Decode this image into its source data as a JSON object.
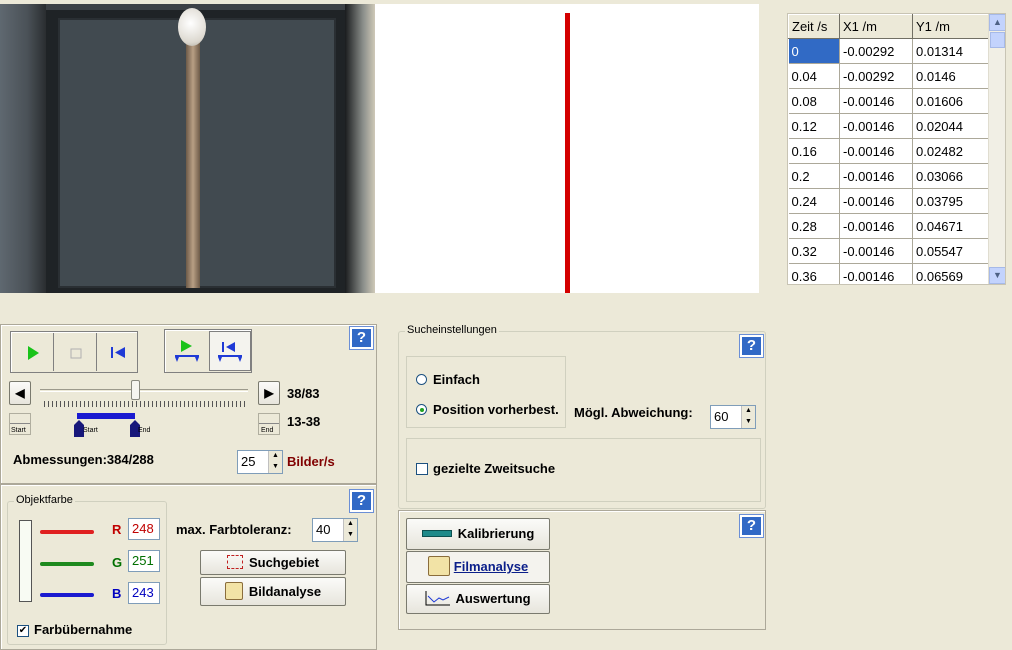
{
  "table": {
    "headers": [
      "Zeit /s",
      "X1 /m",
      "Y1 /m"
    ],
    "rows": [
      [
        "0",
        "-0.00292",
        "0.01314"
      ],
      [
        "0.04",
        "-0.00292",
        "0.0146"
      ],
      [
        "0.08",
        "-0.00146",
        "0.01606"
      ],
      [
        "0.12",
        "-0.00146",
        "0.02044"
      ],
      [
        "0.16",
        "-0.00146",
        "0.02482"
      ],
      [
        "0.2",
        "-0.00146",
        "0.03066"
      ],
      [
        "0.24",
        "-0.00146",
        "0.03795"
      ],
      [
        "0.28",
        "-0.00146",
        "0.04671"
      ],
      [
        "0.32",
        "-0.00146",
        "0.05547"
      ],
      [
        "0.36",
        "-0.00146",
        "0.06569"
      ]
    ]
  },
  "player": {
    "frame_counter": "38/83",
    "range": "13-38",
    "start_label": "Start",
    "end_label": "End",
    "marker_start": "Start",
    "marker_end": "End",
    "dimensions": "Abmessungen:384/288",
    "fps_value": "25",
    "fps_label": "Bilder/s",
    "slider_position": 0.46
  },
  "object_color": {
    "legend": "Objektfarbe",
    "r_label": "R",
    "r_value": "248",
    "g_label": "G",
    "g_value": "251",
    "b_label": "B",
    "b_value": "243",
    "tolerance_label": "max. Farbtoleranz:",
    "tolerance_value": "40",
    "search_area_button": "Suchgebiet",
    "image_analysis_button": "Bildanalyse",
    "color_takeover_label": "Farbübernahme",
    "color_takeover_checked": true,
    "colors": {
      "r": "#e02020",
      "g": "#1e8a1e",
      "b": "#1a1ad0",
      "r_text": "#c00000",
      "g_text": "#007000",
      "b_text": "#0000c0"
    }
  },
  "search": {
    "legend": "Sucheinstellungen",
    "simple_label": "Einfach",
    "position_label": "Position vorherbest.",
    "selected": "position",
    "deviation_label": "Mögl. Abweichung:",
    "deviation_value": "60",
    "second_search_label": "gezielte Zweitsuche"
  },
  "nav": {
    "calibration": "Kalibrierung",
    "film_analysis": "Filmanalyse",
    "evaluation": "Auswertung"
  },
  "help_symbol": "?"
}
